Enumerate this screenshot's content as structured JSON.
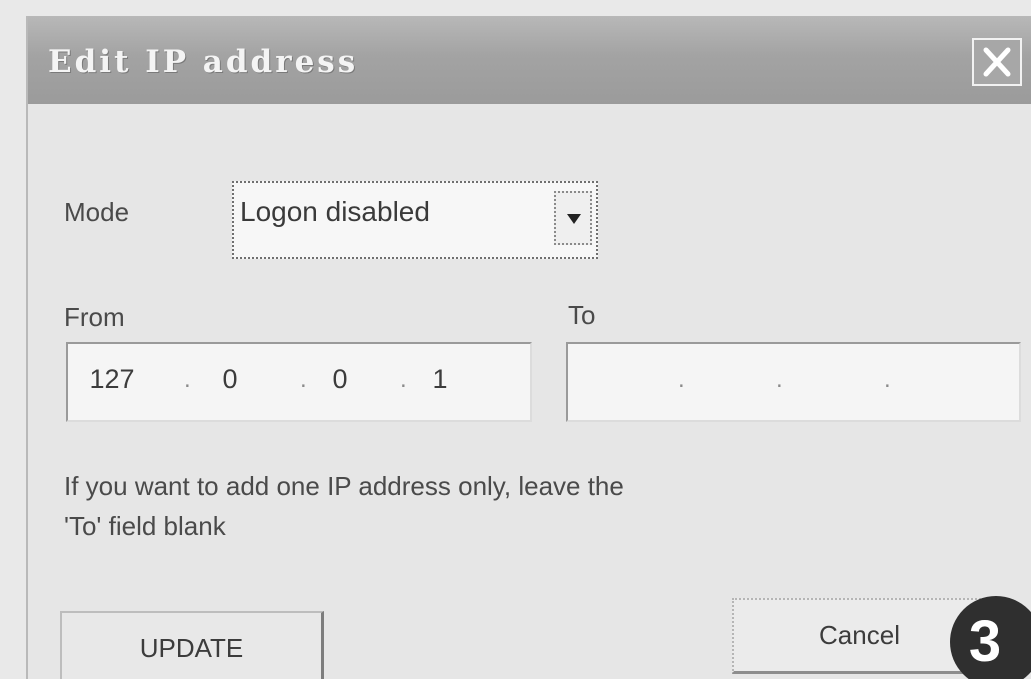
{
  "window": {
    "title": "Edit IP address",
    "close_icon": "close-icon"
  },
  "form": {
    "mode_label": "Mode",
    "mode_value": "Logon disabled",
    "from_label": "From",
    "to_label": "To",
    "from_ip": [
      "127",
      "0",
      "0",
      "1"
    ],
    "to_ip": [
      "",
      "",
      "",
      ""
    ],
    "hint_line1": "If you want to add one IP address only, leave the",
    "hint_line2": "'To' field blank"
  },
  "buttons": {
    "update_label": "UPDATE",
    "cancel_label": "Cancel"
  },
  "annotation": {
    "step_number": "3"
  },
  "colors": {
    "titlebar": "#a3a3a3",
    "dialog_bg": "#e6e6e6",
    "badge": "#2f2f2f"
  }
}
